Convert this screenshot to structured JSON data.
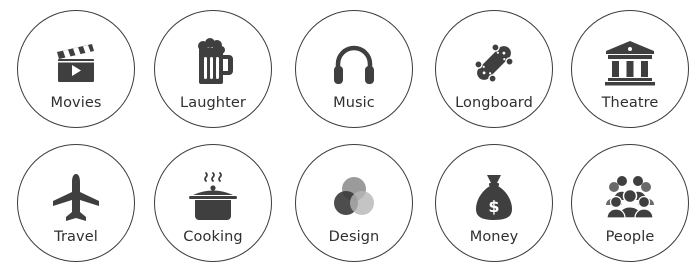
{
  "colors": {
    "icon": "#3f3f3f",
    "border": "#3d3d3d",
    "text": "#2f2f2f",
    "background": "#ffffff"
  },
  "interests": [
    {
      "label": "Movies",
      "icon": "clapperboard-icon"
    },
    {
      "label": "Laughter",
      "icon": "beer-mug-icon"
    },
    {
      "label": "Music",
      "icon": "headphones-icon"
    },
    {
      "label": "Longboard",
      "icon": "skateboard-icon"
    },
    {
      "label": "Theatre",
      "icon": "theatre-building-icon"
    },
    {
      "label": "Travel",
      "icon": "airplane-icon"
    },
    {
      "label": "Cooking",
      "icon": "cooking-pot-icon"
    },
    {
      "label": "Design",
      "icon": "overlapping-circles-icon"
    },
    {
      "label": "Money",
      "icon": "money-bag-icon"
    },
    {
      "label": "People",
      "icon": "people-group-icon"
    }
  ]
}
